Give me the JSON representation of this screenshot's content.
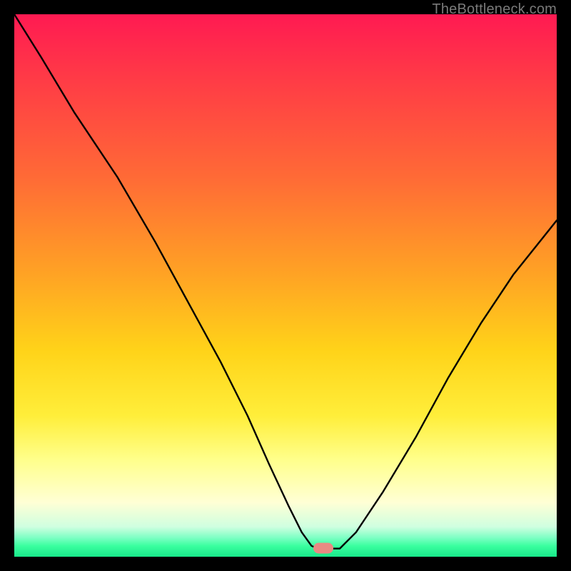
{
  "watermark": "TheBottleneck.com",
  "marker": {
    "x_frac": 0.57,
    "y_frac": 0.984
  },
  "chart_data": {
    "type": "line",
    "title": "",
    "xlabel": "",
    "ylabel": "",
    "xlim": [
      0,
      1
    ],
    "ylim": [
      0,
      1
    ],
    "series": [
      {
        "name": "left-branch",
        "x": [
          0.0,
          0.05,
          0.11,
          0.19,
          0.26,
          0.32,
          0.38,
          0.43,
          0.47,
          0.505,
          0.53,
          0.548,
          0.56
        ],
        "y": [
          1.0,
          0.92,
          0.82,
          0.7,
          0.58,
          0.47,
          0.36,
          0.26,
          0.17,
          0.095,
          0.045,
          0.02,
          0.015
        ]
      },
      {
        "name": "flat-min",
        "x": [
          0.56,
          0.6
        ],
        "y": [
          0.015,
          0.015
        ]
      },
      {
        "name": "right-branch",
        "x": [
          0.6,
          0.63,
          0.68,
          0.74,
          0.8,
          0.86,
          0.92,
          1.0
        ],
        "y": [
          0.015,
          0.045,
          0.12,
          0.22,
          0.33,
          0.43,
          0.52,
          0.62
        ]
      }
    ],
    "marker_point": {
      "x": 0.57,
      "y": 0.016
    }
  }
}
